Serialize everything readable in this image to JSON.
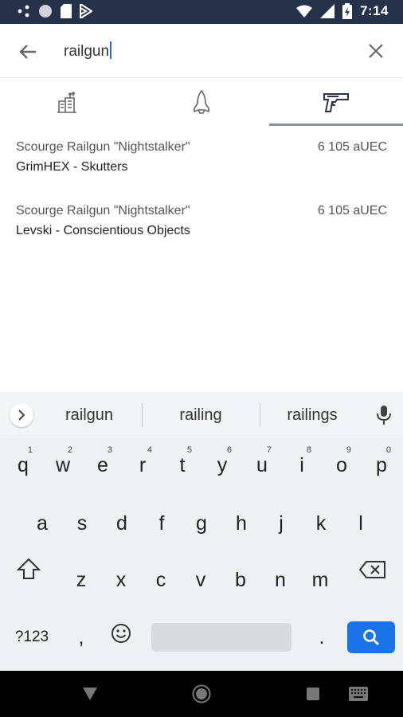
{
  "status_bar": {
    "time": "7:14"
  },
  "search": {
    "query": "railgun"
  },
  "tabs": [
    {
      "name": "stations",
      "icon": "building-icon",
      "selected": false
    },
    {
      "name": "ships",
      "icon": "spaceship-icon",
      "selected": false
    },
    {
      "name": "weapons",
      "icon": "gun-icon",
      "selected": true
    }
  ],
  "results": [
    {
      "name": "Scourge Railgun \"Nightstalker\"",
      "price": "6 105 aUEC",
      "location": "GrimHEX - Skutters"
    },
    {
      "name": "Scourge Railgun \"Nightstalker\"",
      "price": "6 105 aUEC",
      "location": "Levski - Conscientious Objects"
    }
  ],
  "keyboard": {
    "suggestions": [
      "railgun",
      "railing",
      "railings"
    ],
    "row1": [
      {
        "k": "q",
        "n": "1"
      },
      {
        "k": "w",
        "n": "2"
      },
      {
        "k": "e",
        "n": "3"
      },
      {
        "k": "r",
        "n": "4"
      },
      {
        "k": "t",
        "n": "5"
      },
      {
        "k": "y",
        "n": "6"
      },
      {
        "k": "u",
        "n": "7"
      },
      {
        "k": "i",
        "n": "8"
      },
      {
        "k": "o",
        "n": "9"
      },
      {
        "k": "p",
        "n": "0"
      }
    ],
    "row2": [
      "a",
      "s",
      "d",
      "f",
      "g",
      "h",
      "j",
      "k",
      "l"
    ],
    "row3": [
      "z",
      "x",
      "c",
      "v",
      "b",
      "n",
      "m"
    ],
    "symbols_label": "?123",
    "comma": ",",
    "period": "."
  },
  "colors": {
    "accent": "#1a73e8",
    "status_bar": "#25324a",
    "tab_indicator": "#8a93a0"
  }
}
